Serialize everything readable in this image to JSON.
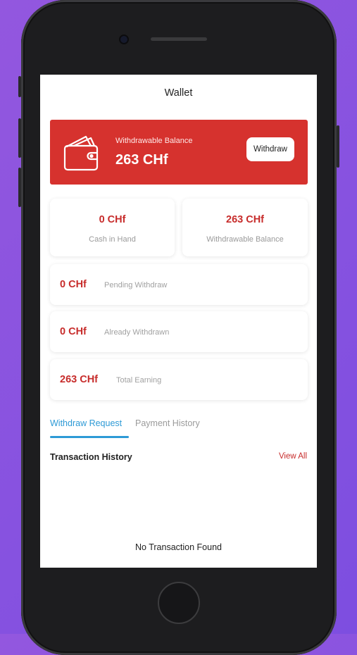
{
  "header": {
    "title": "Wallet"
  },
  "balance_card": {
    "label": "Withdrawable Balance",
    "value": "263 CHf",
    "button_label": "Withdraw",
    "color": "#d6322e"
  },
  "stats": [
    {
      "value": "0 CHf",
      "label": "Cash in Hand"
    },
    {
      "value": "263 CHf",
      "label": "Withdrawable Balance"
    }
  ],
  "rows": [
    {
      "value": "0 CHf",
      "label": "Pending Withdraw"
    },
    {
      "value": "0 CHf",
      "label": "Already Withdrawn"
    },
    {
      "value": "263 CHf",
      "label": "Total Earning"
    }
  ],
  "tabs": [
    {
      "label": "Withdraw Request",
      "active": true
    },
    {
      "label": "Payment History",
      "active": false
    }
  ],
  "transactions": {
    "title": "Transaction History",
    "view_all": "View All",
    "empty_message": "No Transaction Found"
  },
  "colors": {
    "accent_red": "#c72c2b",
    "tab_blue": "#2d9ad6",
    "background": "#8a55df"
  }
}
